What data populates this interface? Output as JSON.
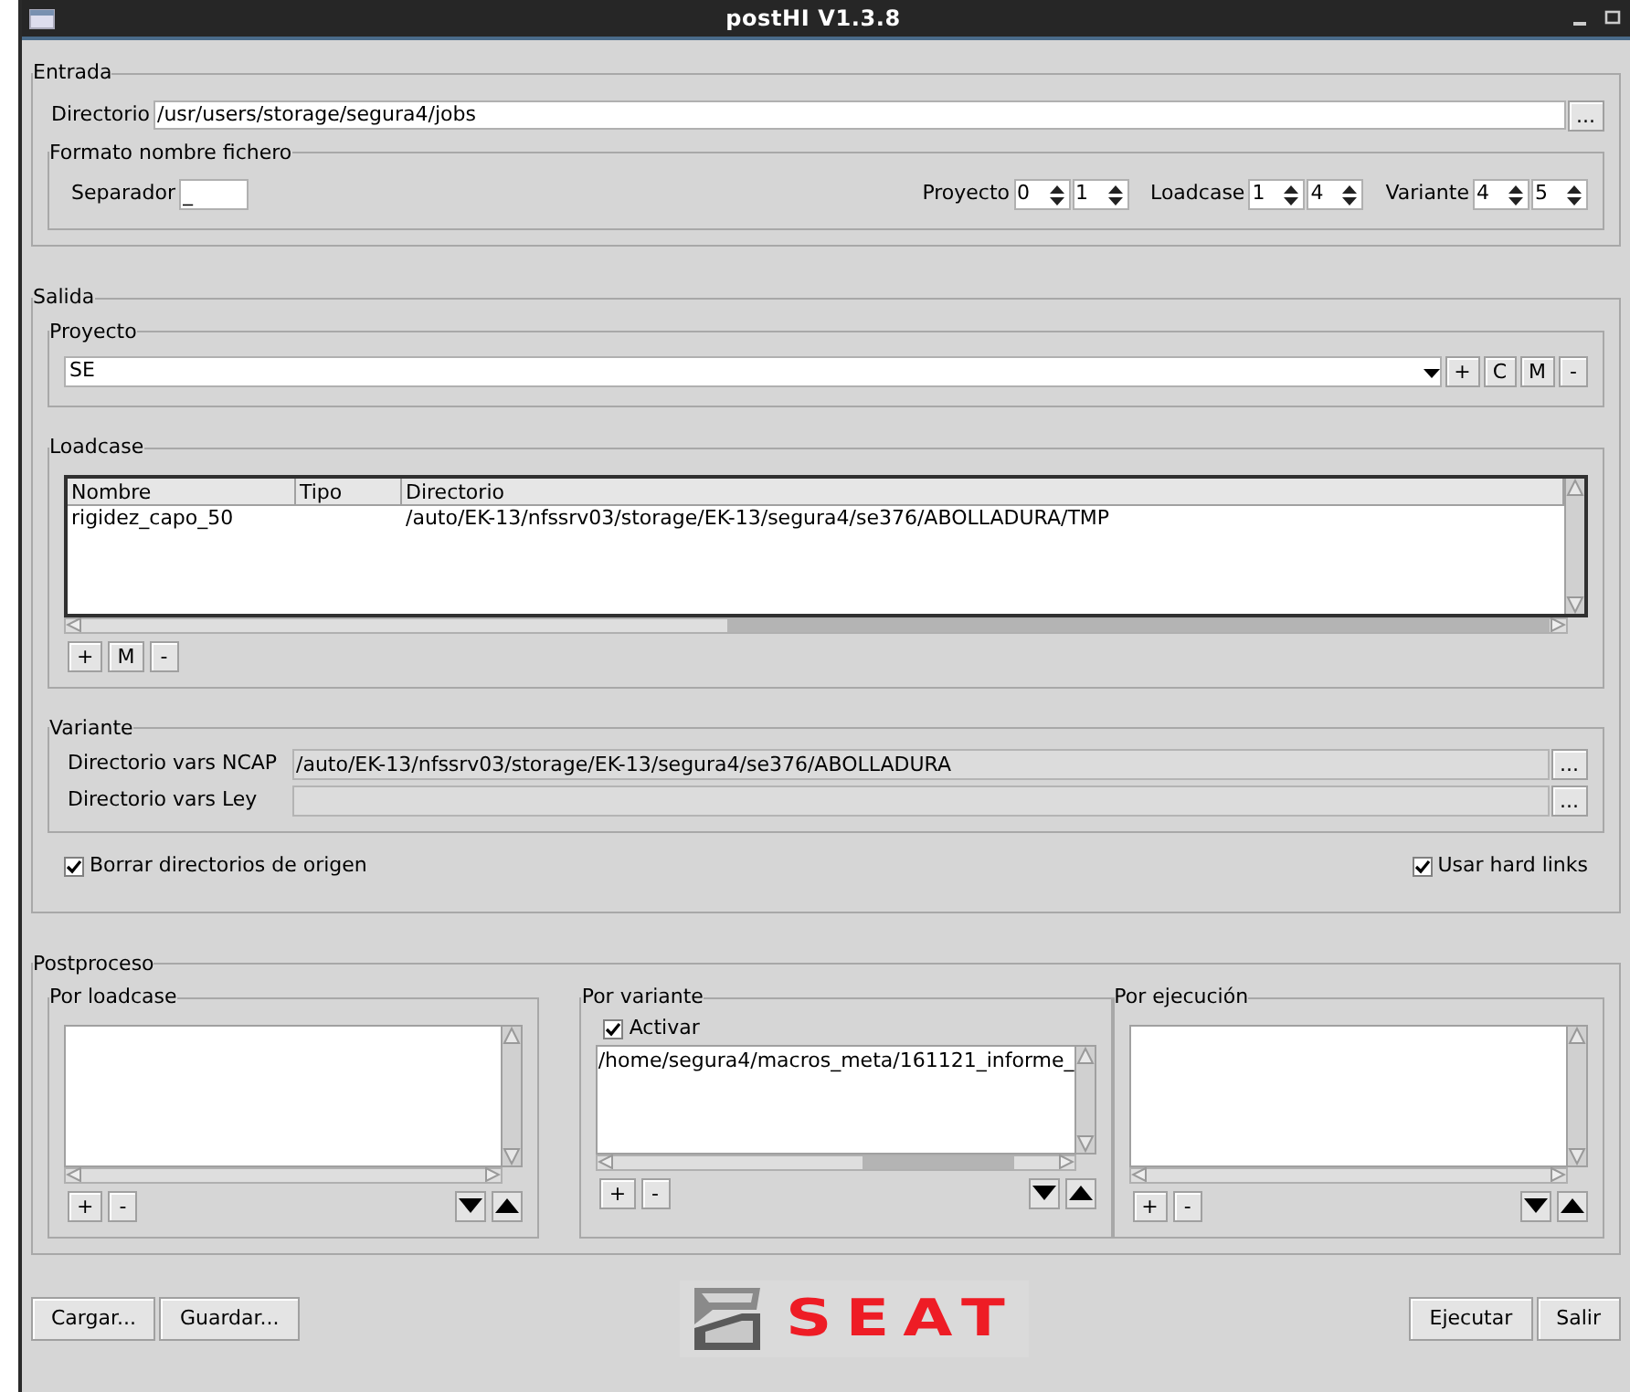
{
  "window": {
    "title": "postHI V1.3.8"
  },
  "entrada": {
    "title": "Entrada",
    "directorio": {
      "label": "Directorio",
      "value": "/usr/users/storage/segura4/jobs",
      "browse": "..."
    },
    "formato": {
      "title": "Formato nombre fichero",
      "separador": {
        "label": "Separador",
        "value": "_"
      },
      "spin_groups": [
        {
          "label": "Proyecto",
          "values": [
            "0",
            "1"
          ]
        },
        {
          "label": "Loadcase",
          "values": [
            "1",
            "4"
          ]
        },
        {
          "label": "Variante",
          "values": [
            "4",
            "5"
          ]
        }
      ]
    }
  },
  "salida": {
    "title": "Salida",
    "proyecto": {
      "title": "Proyecto",
      "value": "SE",
      "buttons": [
        "+",
        "C",
        "M",
        "-"
      ]
    },
    "loadcase": {
      "title": "Loadcase",
      "columns": [
        "Nombre",
        "Tipo",
        "Directorio"
      ],
      "rows": [
        {
          "nombre": "rigidez_capo_50",
          "directorio": "/auto/EK-13/nfssrv03/storage/EK-13/segura4/se376/ABOLLADURA/TMP"
        }
      ],
      "buttons": [
        "+",
        "M",
        "-"
      ]
    },
    "variante": {
      "title": "Variante",
      "fields": [
        {
          "label": "Directorio vars NCAP",
          "value": "/auto/EK-13/nfssrv03/storage/EK-13/segura4/se376/ABOLLADURA",
          "browse": "..."
        },
        {
          "label": "Directorio vars Ley",
          "browse": "..."
        }
      ]
    },
    "checkboxes": [
      {
        "label": "Borrar directorios de origen",
        "checked": true
      },
      {
        "label": "Usar hard links",
        "checked": true
      }
    ]
  },
  "postproceso": {
    "title": "Postproceso",
    "panels": [
      {
        "title": "Por loadcase",
        "buttons": [
          "+",
          "-"
        ]
      },
      {
        "title": "Por variante",
        "activar": {
          "label": "Activar",
          "checked": true
        },
        "items": [
          "/home/segura4/macros_meta/161121_informe_"
        ],
        "buttons": [
          "+",
          "-"
        ]
      },
      {
        "title": "Por ejecución",
        "buttons": [
          "+",
          "-"
        ]
      }
    ]
  },
  "footer": {
    "left_buttons": [
      "Cargar...",
      "Guardar..."
    ],
    "logo": "SEAT",
    "right_buttons": [
      "Ejecutar",
      "Salir"
    ]
  }
}
